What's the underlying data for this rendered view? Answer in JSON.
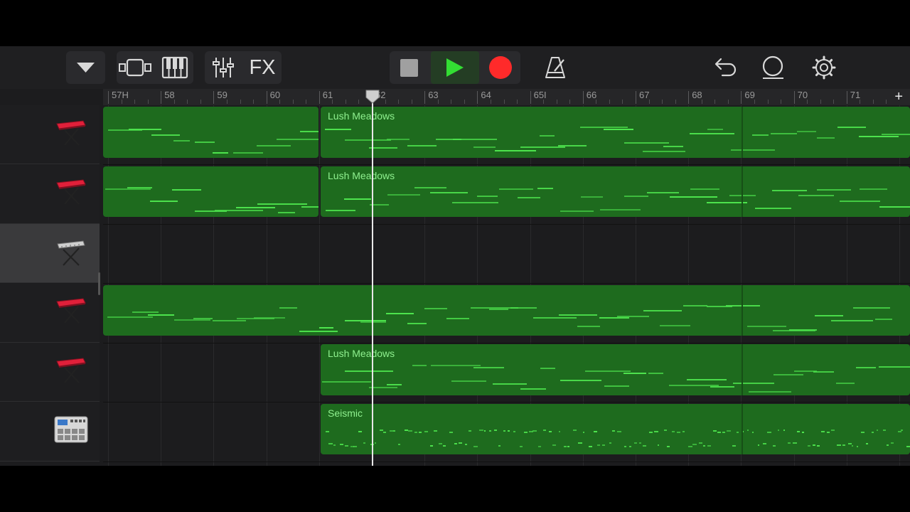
{
  "toolbar": {
    "fx_label": "FX",
    "icons": [
      "browser-toggle-icon",
      "tracks-view-icon",
      "instrument-view-icon",
      "mixer-icon",
      "fx-icon",
      "stop-icon",
      "play-icon",
      "record-icon",
      "metronome-icon",
      "undo-icon",
      "loop-icon",
      "settings-icon"
    ],
    "colors": {
      "play": "#33dd33",
      "record": "#ff2a2a",
      "stop": "#9a9a9a"
    }
  },
  "ruler": {
    "bars": [
      "57H",
      "58",
      "59",
      "60",
      "61",
      "62",
      "63",
      "64",
      "65I",
      "66",
      "67",
      "68",
      "69",
      "70",
      "71"
    ],
    "add_label": "+"
  },
  "tracks": [
    {
      "instrument": "red-synth-keyboard-icon",
      "regions": [
        {
          "label": ""
        },
        {
          "label": "Lush Meadows"
        }
      ]
    },
    {
      "instrument": "red-synth-keyboard-icon",
      "regions": [
        {
          "label": ""
        },
        {
          "label": "Lush Meadows"
        }
      ]
    },
    {
      "instrument": "grey-keyboard-stand-icon",
      "selected": true,
      "regions": []
    },
    {
      "instrument": "red-synth-keyboard-icon",
      "regions": [
        {
          "label": ""
        }
      ]
    },
    {
      "instrument": "red-synth-keyboard-icon",
      "regions": [
        {
          "label": "Lush Meadows"
        }
      ]
    },
    {
      "instrument": "drum-machine-icon",
      "regions": [
        {
          "label": "Seismic"
        }
      ]
    }
  ],
  "colors": {
    "region": "#1e6b1e",
    "note": "#4ee64e",
    "region_label": "#8ff08f"
  }
}
